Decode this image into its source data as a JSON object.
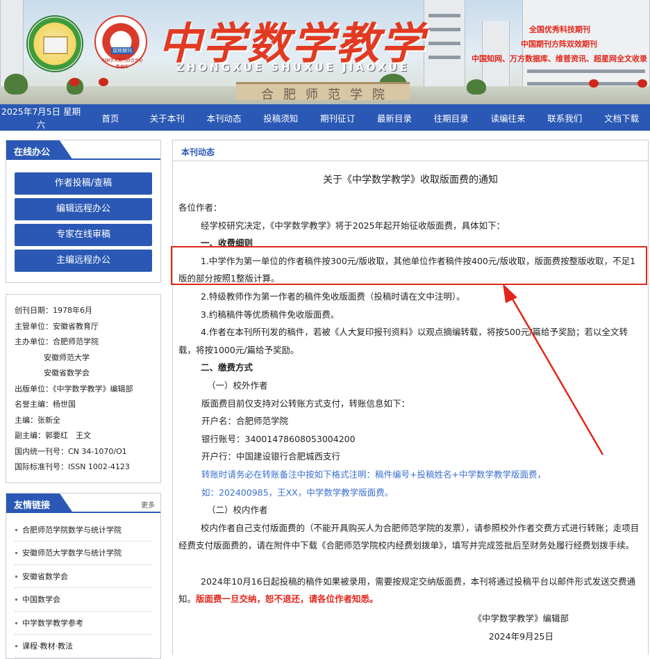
{
  "banner": {
    "logo_left": "中国学术期刊",
    "logo_right_tag": "双效期刊",
    "logo_right_caption": "中国学术期刊综合评价数据库",
    "title": "中学数学教学",
    "pinyin": "ZHONGXUE SHUXUE JIAOXUE",
    "school_sign": "合肥师范学院",
    "honors": [
      "全国优秀科技期刊",
      "中国期刊方阵双效期刊",
      "中国知网、万方数据库、维普资讯、超星网全文收录"
    ]
  },
  "nav": {
    "date": "2025年7月5日 星期六",
    "items": [
      "首页",
      "关于本刊",
      "本刊动态",
      "投稿须知",
      "期刊征订",
      "最新目录",
      "往期目录",
      "读编往来",
      "联系我们",
      "文档下载"
    ]
  },
  "sidebar": {
    "office_title": "在线办公",
    "office_buttons": [
      "作者投稿/查稿",
      "编辑远程办公",
      "专家在线审稿",
      "主编远程办公"
    ],
    "info": [
      "创刊日期：1978年6月",
      "主管单位：安徽省教育厅",
      "主办单位：合肥师范学院",
      "安徽师范大学",
      "安徽省数学会",
      "出版单位：《中学数学教学》编辑部",
      "名誉主编：杨世国",
      "主编：张新全",
      "副主编：郭要红　王文",
      "国内统一刊号：CN 34-1070/O1",
      "国际标准刊号：ISSN 1002-4123"
    ],
    "links_title": "友情链接",
    "links_more": "更多",
    "links": [
      "合肥师范学院数学与统计学院",
      "安徽师范大学数学与统计学院",
      "安徽省数学会",
      "中国数学会",
      "中学数学教学参考",
      "课程·教材·教法"
    ]
  },
  "main": {
    "section": "本刊动态",
    "title": "关于《中学数学教学》收取版面费的通知",
    "greeting": "各位作者：",
    "intro": "经学校研究决定，《中学数学教学》将于2025年起开始征收版面费，具体如下：",
    "h1": "一、收费细则",
    "rule1": "1.中学作为第一单位的作者稿件按300元/版收取，其他单位作者稿件按400元/版收取，版面费按整版收取，不足1版的部分按照1整版计算。",
    "rule2": "2.特级教师作为第一作者的稿件免收版面费（投稿时请在文中注明）。",
    "rule3": "3.约稿稿件等优质稿件免收版面费。",
    "rule4": "4.作者在本刊所刊发的稿件，若被《人大复印报刊资料》以观点摘编转载，将按500元/篇给予奖励；若以全文转载，将按1000元/篇给予奖励。",
    "h2": "二、缴费方式",
    "sub1": "（一）校外作者",
    "pay_intro": "版面费目前仅支持对公转账方式支付，转账信息如下：",
    "account_name": "开户名：合肥师范学院",
    "account_no": "银行账号：34001478608053004200",
    "bank": "开户行：中国建设银行合肥城西支行",
    "note_line1": "转账时请务必在转账备注中按如下格式注明：稿件编号+投稿姓名+中学数学教学版面费，",
    "note_line2": "如：202400985，王XX，中学数学教学版面费。",
    "sub2": "（二）校内作者",
    "internal": "校内作者自己支付版面费的（不能开具购买人为合肥师范学院的发票），请参照校外作者交费方式进行转账；走项目经费支付版面费的，请在附件中下载《合肥师范学院校内经费划拨单》，填写并完成签批后至财务处履行经费划拨手续。",
    "notice": "2024年10月16日起投稿的稿件如果被录用，需要按规定交纳版面费，本刊将通过投稿平台以邮件形式发送交费通知。",
    "notice_red": "版面费一旦交纳，恕不退还，请各位作者知悉。",
    "sign": "《中学数学教学》编辑部",
    "date": "2024年9月25日"
  },
  "colors": {
    "nav": "#2a58b4",
    "accent_red": "#e2261b",
    "note_blue": "#3a6fd0"
  }
}
